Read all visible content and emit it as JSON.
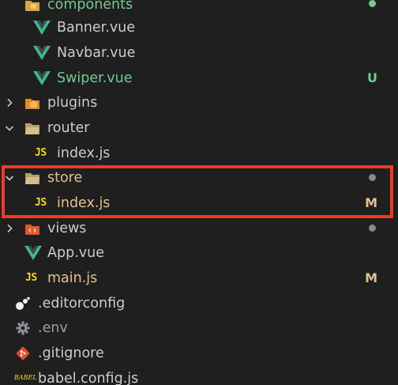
{
  "explorer": {
    "items": [
      {
        "id": "components",
        "label": "components",
        "status_dot_color": "#73c991"
      },
      {
        "id": "banner",
        "label": "Banner.vue"
      },
      {
        "id": "navbar",
        "label": "Navbar.vue"
      },
      {
        "id": "swiper",
        "label": "Swiper.vue",
        "status": "U"
      },
      {
        "id": "plugins",
        "label": "plugins"
      },
      {
        "id": "router",
        "label": "router"
      },
      {
        "id": "router-index",
        "label": "index.js",
        "icon_text": "JS"
      },
      {
        "id": "store",
        "label": "store",
        "status_dot_color": "#8a8a8a"
      },
      {
        "id": "store-index",
        "label": "index.js",
        "icon_text": "JS",
        "status": "M"
      },
      {
        "id": "views",
        "label": "views",
        "status_dot_color": "#8a8a8a"
      },
      {
        "id": "app",
        "label": "App.vue"
      },
      {
        "id": "main",
        "label": "main.js",
        "icon_text": "JS",
        "status": "M"
      },
      {
        "id": "editorconfig",
        "label": ".editorconfig"
      },
      {
        "id": "env",
        "label": ".env"
      },
      {
        "id": "gitignore",
        "label": ".gitignore"
      },
      {
        "id": "babel",
        "label": "babel.config.js",
        "icon_text": "BABEL"
      }
    ]
  },
  "colors": {
    "background": "#1f1f20",
    "text": "#cccccc",
    "untracked": "#73c991",
    "modified": "#e2c08d",
    "vue_green": "#41b883",
    "js_yellow": "#f5de19",
    "highlight_border": "#f23a1e"
  },
  "icons": {
    "components": "folder-components-icon",
    "vue": "vue-icon",
    "plugins": "plugins-folder-icon",
    "router": "folder-open-icon",
    "js": "javascript-icon",
    "views": "views-folder-icon",
    "editorconfig": "editorconfig-icon",
    "env": "gear-icon",
    "git": "git-icon",
    "babel": "babel-icon"
  }
}
